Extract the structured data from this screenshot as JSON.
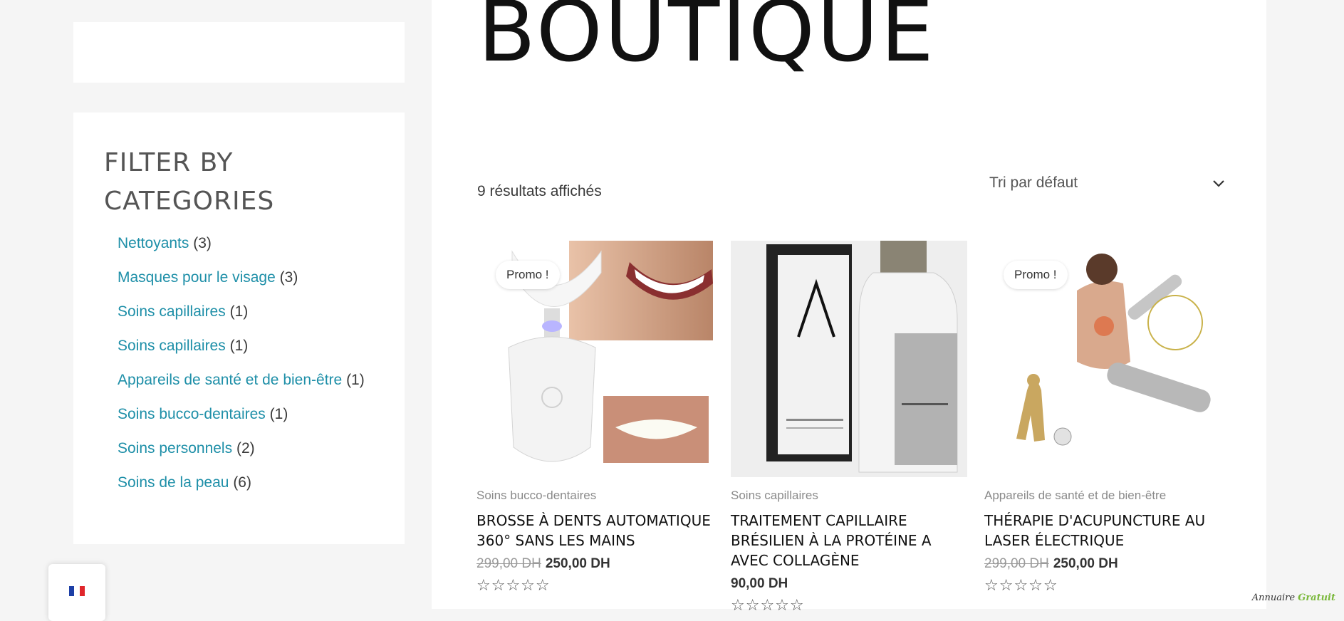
{
  "page": {
    "title": "BOUTIQUE"
  },
  "sidebar": {
    "widget_title": "FILTER BY CATEGORIES",
    "categories": [
      {
        "label": "Nettoyants",
        "count": "(3)"
      },
      {
        "label": "Masques pour le visage",
        "count": "(3)"
      },
      {
        "label": "Soins capillaires",
        "count": "(1)"
      },
      {
        "label": "Soins capillaires",
        "count": "(1)"
      },
      {
        "label": "Appareils de santé et de bien-être",
        "count": "(1)"
      },
      {
        "label": "Soins bucco-dentaires",
        "count": "(1)"
      },
      {
        "label": "Soins personnels",
        "count": "(2)"
      },
      {
        "label": "Soins de la peau",
        "count": "(6)"
      }
    ]
  },
  "shop": {
    "result_count": "9 résultats affichés",
    "sort_selected": "Tri par défaut"
  },
  "products": [
    {
      "badge": "Promo !",
      "category": "Soins bucco-dentaires",
      "title": "Brosse à dents automatique 360° sans les mains",
      "old_price": "299,00 DH",
      "price": "250,00 DH",
      "rating": 0
    },
    {
      "badge": "",
      "category": "Soins capillaires",
      "title": "Traitement capillaire brésilien à la protéine A avec collagène",
      "old_price": "",
      "price": "90,00 DH",
      "rating": 0
    },
    {
      "badge": "Promo !",
      "category": "Appareils de santé et de bien-être",
      "title": "Thérapie d'acupuncture au laser électrique",
      "old_price": "299,00 DH",
      "price": "250,00 DH",
      "rating": 0
    }
  ],
  "icons": {
    "sort": "chevron-down-icon",
    "lang": "french-flag-icon",
    "star": "star-outline-icon"
  },
  "colors": {
    "link": "#1e8fa8",
    "background": "#f5f5f5",
    "panel": "#ffffff"
  },
  "watermark": {
    "text_a": "Annuaire",
    "text_b": "Gratuit"
  }
}
